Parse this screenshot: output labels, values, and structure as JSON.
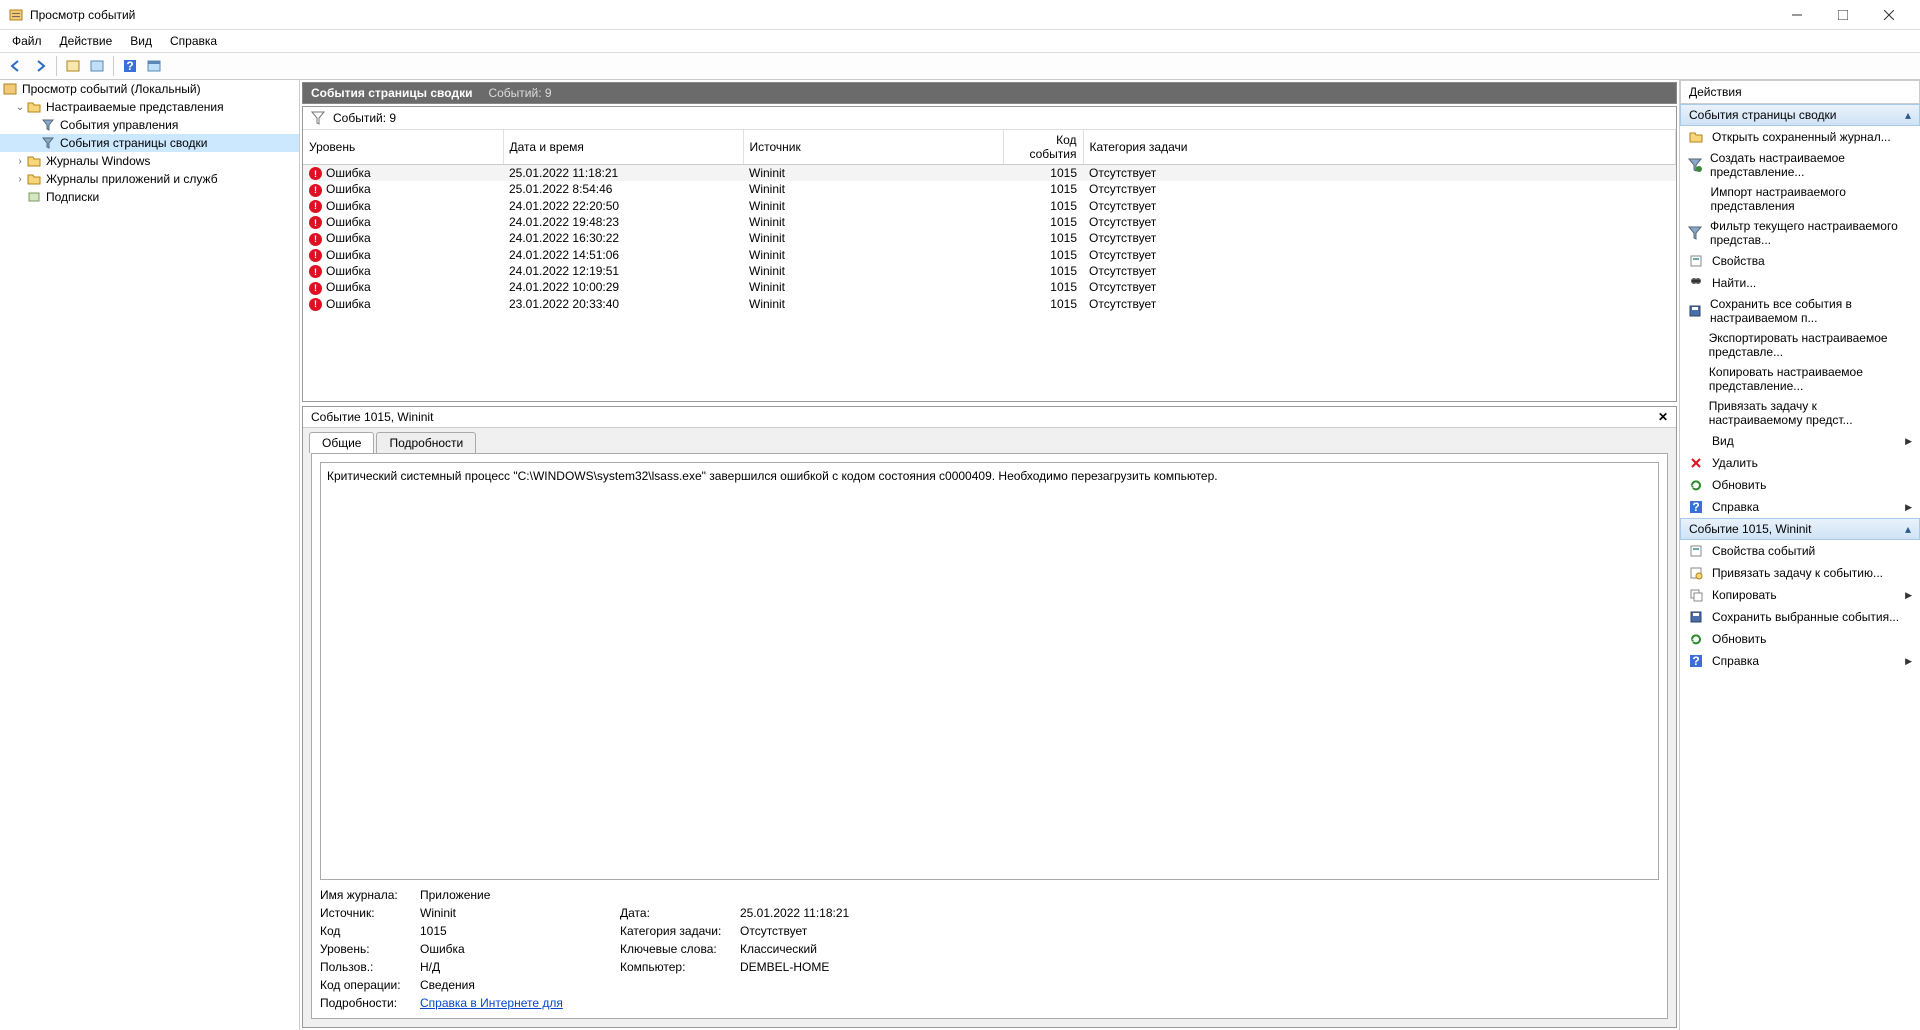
{
  "titlebar": {
    "title": "Просмотр событий"
  },
  "menu": {
    "file": "Файл",
    "action": "Действие",
    "view": "Вид",
    "help": "Справка"
  },
  "tree": {
    "root": "Просмотр событий (Локальный)",
    "custom_views": "Настраиваемые представления",
    "admin_events": "События управления",
    "summary_page_events": "События страницы сводки",
    "windows_logs": "Журналы Windows",
    "app_service_logs": "Журналы приложений и служб",
    "subscriptions": "Подписки"
  },
  "center": {
    "header_title": "События страницы сводки",
    "header_count": "Событий: 9",
    "filter_count": "Событий: 9",
    "columns": {
      "level": "Уровень",
      "datetime": "Дата и время",
      "source": "Источник",
      "event_id": "Код события",
      "task_cat": "Категория задачи"
    },
    "rows": [
      {
        "level": "Ошибка",
        "dt": "25.01.2022 11:18:21",
        "src": "Wininit",
        "id": "1015",
        "cat": "Отсутствует"
      },
      {
        "level": "Ошибка",
        "dt": "25.01.2022 8:54:46",
        "src": "Wininit",
        "id": "1015",
        "cat": "Отсутствует"
      },
      {
        "level": "Ошибка",
        "dt": "24.01.2022 22:20:50",
        "src": "Wininit",
        "id": "1015",
        "cat": "Отсутствует"
      },
      {
        "level": "Ошибка",
        "dt": "24.01.2022 19:48:23",
        "src": "Wininit",
        "id": "1015",
        "cat": "Отсутствует"
      },
      {
        "level": "Ошибка",
        "dt": "24.01.2022 16:30:22",
        "src": "Wininit",
        "id": "1015",
        "cat": "Отсутствует"
      },
      {
        "level": "Ошибка",
        "dt": "24.01.2022 14:51:06",
        "src": "Wininit",
        "id": "1015",
        "cat": "Отсутствует"
      },
      {
        "level": "Ошибка",
        "dt": "24.01.2022 12:19:51",
        "src": "Wininit",
        "id": "1015",
        "cat": "Отсутствует"
      },
      {
        "level": "Ошибка",
        "dt": "24.01.2022 10:00:29",
        "src": "Wininit",
        "id": "1015",
        "cat": "Отсутствует"
      },
      {
        "level": "Ошибка",
        "dt": "23.01.2022 20:33:40",
        "src": "Wininit",
        "id": "1015",
        "cat": "Отсутствует"
      }
    ]
  },
  "detail": {
    "header": "Событие 1015, Wininit",
    "tab_general": "Общие",
    "tab_details": "Подробности",
    "message": "Критический системный процесс \"C:\\WINDOWS\\system32\\lsass.exe\" завершился ошибкой с кодом состояния c0000409.  Необходимо перезагрузить компьютер.",
    "labels": {
      "log_name": "Имя журнала:",
      "source": "Источник:",
      "code": "Код",
      "level": "Уровень:",
      "user": "Пользов.:",
      "op_code": "Код операции:",
      "details": "Подробности:",
      "date": "Дата:",
      "task_cat": "Категория задачи:",
      "keywords": "Ключевые слова:",
      "computer": "Компьютер:"
    },
    "values": {
      "log_name": "Приложение",
      "source": "Wininit",
      "code": "1015",
      "level": "Ошибка",
      "user": "Н/Д",
      "op_code": "Сведения",
      "details_link": "Справка в Интернете для ",
      "date": "25.01.2022 11:18:21",
      "task_cat": "Отсутствует",
      "keywords": "Классический",
      "computer": "DEMBEL-HOME"
    }
  },
  "actions": {
    "header": "Действия",
    "group1_title": "События страницы сводки",
    "group1": [
      {
        "label": "Открыть сохраненный журнал...",
        "icon": "folder"
      },
      {
        "label": "Создать настраиваемое представление...",
        "icon": "filter-new"
      },
      {
        "label": "Импорт настраиваемого представления",
        "icon": "blank"
      },
      {
        "label": "Фильтр текущего настраиваемого представ...",
        "icon": "filter"
      },
      {
        "label": "Свойства",
        "icon": "props"
      },
      {
        "label": "Найти...",
        "icon": "find"
      },
      {
        "label": "Сохранить все события в настраиваемом п...",
        "icon": "save"
      },
      {
        "label": "Экспортировать настраиваемое представле...",
        "icon": "blank"
      },
      {
        "label": "Копировать настраиваемое представление...",
        "icon": "blank"
      },
      {
        "label": "Привязать задачу к настраиваемому предст...",
        "icon": "blank"
      },
      {
        "label": "Вид",
        "icon": "blank",
        "arrow": true
      },
      {
        "label": "Удалить",
        "icon": "delete"
      },
      {
        "label": "Обновить",
        "icon": "refresh"
      },
      {
        "label": "Справка",
        "icon": "help",
        "arrow": true
      }
    ],
    "group2_title": "Событие 1015, Wininit",
    "group2": [
      {
        "label": "Свойства событий",
        "icon": "props"
      },
      {
        "label": "Привязать задачу к событию...",
        "icon": "task"
      },
      {
        "label": "Копировать",
        "icon": "copy",
        "arrow": true
      },
      {
        "label": "Сохранить выбранные события...",
        "icon": "save"
      },
      {
        "label": "Обновить",
        "icon": "refresh"
      },
      {
        "label": "Справка",
        "icon": "help",
        "arrow": true
      }
    ]
  }
}
